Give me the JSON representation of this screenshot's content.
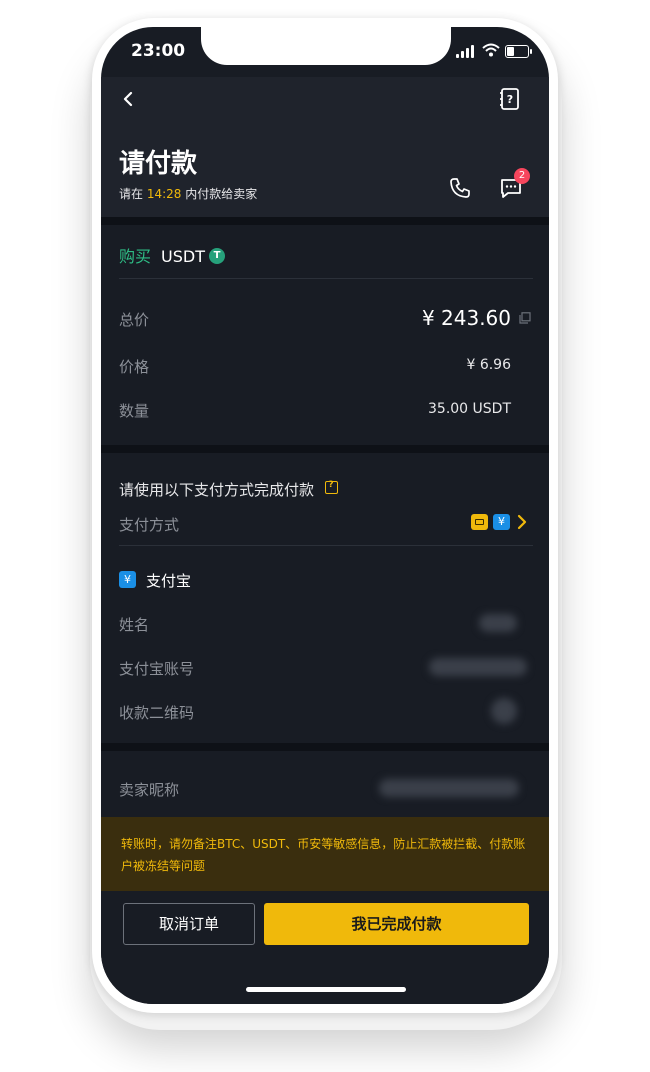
{
  "status_bar": {
    "time": "23:00"
  },
  "header": {
    "title": "请付款",
    "subtitle_prefix": "请在",
    "countdown": "14:28",
    "subtitle_suffix": "内付款给卖家",
    "chat_badge_count": "2"
  },
  "order": {
    "side": "购买",
    "asset": "USDT",
    "rows": [
      {
        "label": "总价",
        "value": "¥ 243.60"
      },
      {
        "label": "价格",
        "value": "¥ 6.96"
      },
      {
        "label": "数量",
        "value": "35.00 USDT"
      }
    ]
  },
  "payment": {
    "section_title": "请使用以下支付方式完成付款",
    "method_label": "支付方式",
    "alipay_title": "支付宝",
    "alipay_glyph": "¥",
    "fields": [
      {
        "label": "姓名"
      },
      {
        "label": "支付宝账号"
      },
      {
        "label": "收款二维码"
      }
    ]
  },
  "seller": {
    "label": "卖家昵称"
  },
  "warning": {
    "text": "转账时，请勿备注BTC、USDT、币安等敏感信息，防止汇款被拦截、付款账户被冻结等问题"
  },
  "footer": {
    "cancel_label": "取消订单",
    "confirm_label": "我已完成付款"
  },
  "colors": {
    "background": "#181c24",
    "accent": "#f0b90b",
    "buy_green": "#2ebd85",
    "badge_red": "#f6465d",
    "alipay_blue": "#1a8fe6"
  }
}
